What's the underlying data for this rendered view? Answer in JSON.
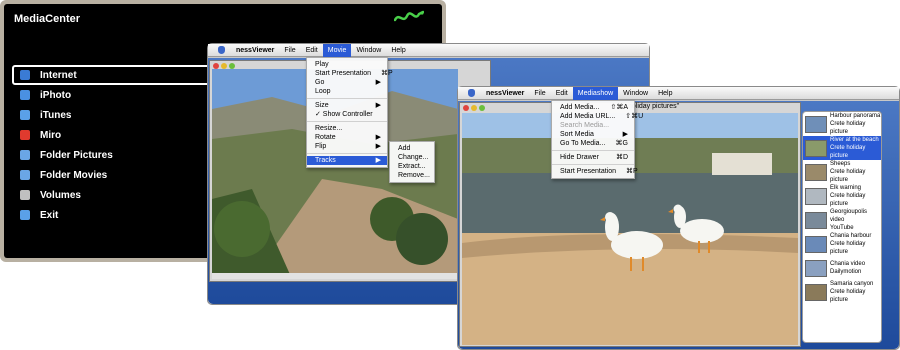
{
  "mediacenter": {
    "title": "MediaCenter",
    "items": [
      {
        "label": "Internet",
        "icon": "globe-icon",
        "color": "#3a7bd5",
        "selected": true
      },
      {
        "label": "iPhoto",
        "icon": "iphoto-icon",
        "color": "#4a90e2",
        "selected": false
      },
      {
        "label": "iTunes",
        "icon": "itunes-icon",
        "color": "#5aa0e8",
        "selected": false
      },
      {
        "label": "Miro",
        "icon": "miro-icon",
        "color": "#e03a2e",
        "selected": false
      },
      {
        "label": "Folder Pictures",
        "icon": "folder-icon",
        "color": "#6aa6e6",
        "selected": false
      },
      {
        "label": "Folder Movies",
        "icon": "folder-icon",
        "color": "#6aa6e6",
        "selected": false
      },
      {
        "label": "Volumes",
        "icon": "drive-icon",
        "color": "#c0c0c0",
        "selected": false
      },
      {
        "label": "Exit",
        "icon": "exit-icon",
        "color": "#5aa0e8",
        "selected": false
      }
    ]
  },
  "viewer1": {
    "menubar": [
      "nessViewer",
      "File",
      "Edit",
      "Movie",
      "Window",
      "Help"
    ],
    "movie_menu": [
      {
        "label": "Play",
        "shortcut": ""
      },
      {
        "label": "Start Presentation",
        "shortcut": "⌘P"
      },
      {
        "label": "Go",
        "shortcut": "▶"
      },
      {
        "label": "Loop",
        "shortcut": ""
      },
      {
        "label": "Size",
        "shortcut": "▶"
      },
      {
        "label": "✓ Show Controller",
        "shortcut": ""
      },
      {
        "label": "Resize...",
        "shortcut": ""
      },
      {
        "label": "Rotate",
        "shortcut": "▶"
      },
      {
        "label": "Flip",
        "shortcut": "▶"
      },
      {
        "label": "Tracks",
        "shortcut": "▶"
      }
    ],
    "tracks_submenu": [
      "Add",
      "Change...",
      "Extract...",
      "Remove..."
    ]
  },
  "viewer2": {
    "menubar": [
      "nessViewer",
      "File",
      "Edit",
      "Mediashow",
      "Window",
      "Help"
    ],
    "window_title": "holiday pictures\"",
    "mediashow_menu": [
      {
        "label": "Add Media...",
        "shortcut": "⇧⌘A",
        "disabled": false
      },
      {
        "label": "Add Media URL...",
        "shortcut": "⇧⌘U",
        "disabled": false
      },
      {
        "label": "Search Media...",
        "shortcut": "",
        "disabled": true
      },
      {
        "label": "Sort Media",
        "shortcut": "▶",
        "disabled": false
      },
      {
        "label": "Go To Media...",
        "shortcut": "⌘G",
        "disabled": false
      },
      {
        "label": "Hide Drawer",
        "shortcut": "⌘D",
        "disabled": false
      },
      {
        "label": "Start Presentation",
        "shortcut": "⌘P",
        "disabled": false
      }
    ],
    "drawer": [
      {
        "title": "Harbour panorama",
        "sub": "Crete holiday picture",
        "selected": false,
        "color": "#6f8fb8"
      },
      {
        "title": "River at the beach",
        "sub": "Crete holiday picture",
        "selected": true,
        "color": "#8a9a6a"
      },
      {
        "title": "Sheeps",
        "sub": "Crete holiday picture",
        "selected": false,
        "color": "#9a8a6a"
      },
      {
        "title": "Elk warning",
        "sub": "Crete holiday picture",
        "selected": false,
        "color": "#b0b8c0"
      },
      {
        "title": "Georgioupolis video",
        "sub": "YouTube",
        "selected": false,
        "color": "#7a8a9a"
      },
      {
        "title": "Chania harbour",
        "sub": "Crete holiday picture",
        "selected": false,
        "color": "#6a8ab8"
      },
      {
        "title": "Chania video",
        "sub": "Dailymotion",
        "selected": false,
        "color": "#8aa0c0"
      },
      {
        "title": "Samaria canyon",
        "sub": "Crete holiday picture",
        "selected": false,
        "color": "#8a7a5a"
      }
    ]
  }
}
